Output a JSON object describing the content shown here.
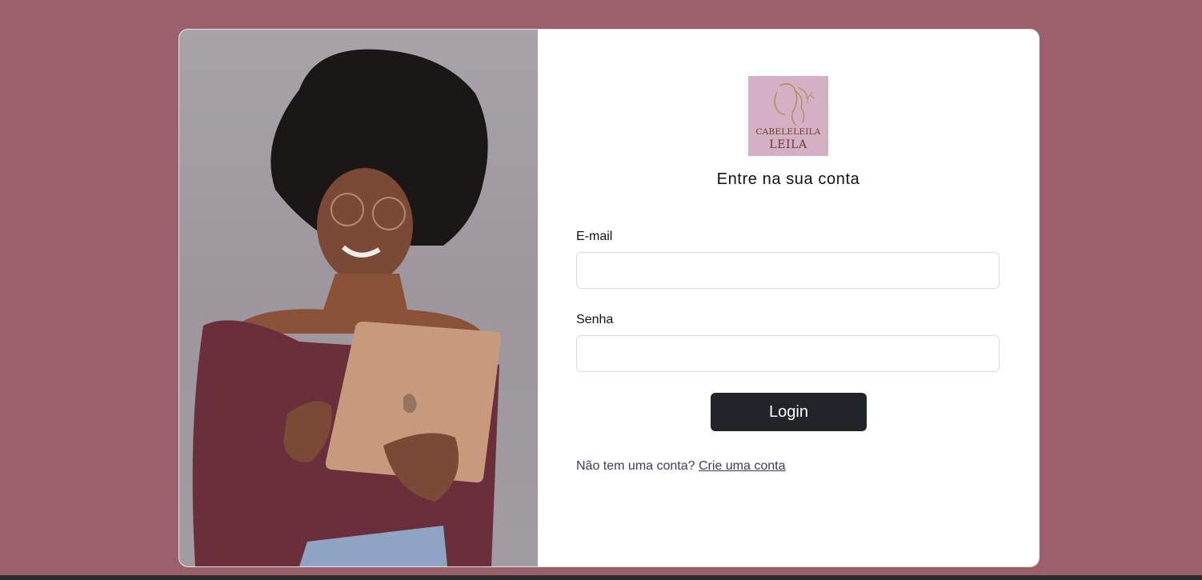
{
  "brand": {
    "logo_line1": "CABELELEILA",
    "logo_line2": "LEILA"
  },
  "login": {
    "heading": "Entre na sua conta",
    "email_label": "E-mail",
    "email_value": "",
    "password_label": "Senha",
    "password_value": "",
    "submit_label": "Login",
    "signup_prompt": "Não tem uma conta?",
    "signup_link": "Crie uma conta"
  },
  "colors": {
    "background": "#9c5f6c",
    "card": "#ffffff",
    "button": "#212529",
    "link": "#3d3a6b",
    "logo_bg": "#d3b0c4"
  }
}
